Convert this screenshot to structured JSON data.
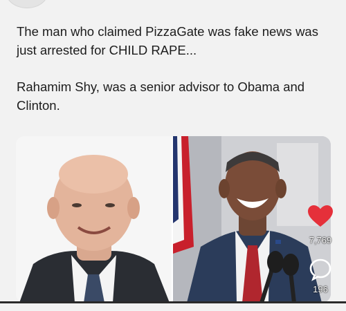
{
  "post": {
    "line1": "The man who claimed PizzaGate was fake news was just arrested for CHILD RAPE...",
    "line2": "Rahamim Shy, was a senior advisor to Obama and Clinton."
  },
  "actions": {
    "likes": "7,769",
    "comments": "196",
    "heart_color": "#e5303a"
  },
  "icons": {
    "like": "heart-icon",
    "comment": "comment-bubble-icon"
  }
}
